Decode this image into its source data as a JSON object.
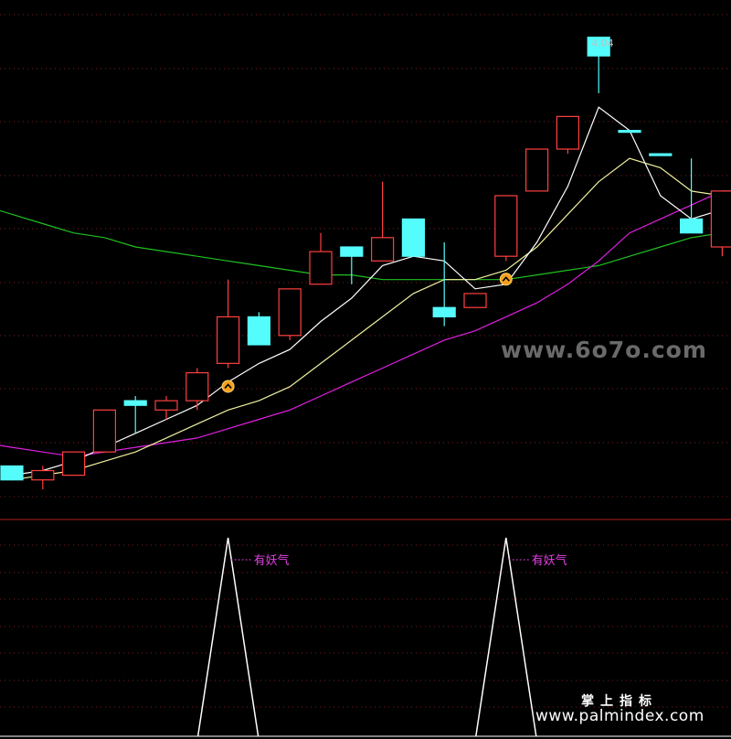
{
  "chart_data": [
    {
      "type": "candlestick",
      "max_price_label": "4.04",
      "colors": {
        "up": "#ff4040",
        "down": "#54fcfc",
        "ma_white": "#ffffff",
        "ma_yellow": "#f0f0a0",
        "ma_magenta": "#e020e0",
        "ma_green": "#20c020",
        "grid": "#7a1f1f",
        "signal_icon": "#f4a21c"
      },
      "candles": [
        {
          "i": 0,
          "o": 3.36,
          "c": 3.33,
          "h": 3.36,
          "l": 3.33,
          "up": false
        },
        {
          "i": 1,
          "o": 3.33,
          "c": 3.35,
          "h": 3.36,
          "l": 3.31,
          "up": true
        },
        {
          "i": 2,
          "o": 3.34,
          "c": 3.39,
          "h": 3.39,
          "l": 3.34,
          "up": true
        },
        {
          "i": 3,
          "o": 3.39,
          "c": 3.48,
          "h": 3.48,
          "l": 3.39,
          "up": true
        },
        {
          "i": 4,
          "o": 3.5,
          "c": 3.49,
          "h": 3.51,
          "l": 3.43,
          "up": false
        },
        {
          "i": 5,
          "o": 3.48,
          "c": 3.5,
          "h": 3.51,
          "l": 3.46,
          "up": true
        },
        {
          "i": 6,
          "o": 3.5,
          "c": 3.56,
          "h": 3.57,
          "l": 3.48,
          "up": true
        },
        {
          "i": 7,
          "o": 3.58,
          "c": 3.68,
          "h": 3.76,
          "l": 3.57,
          "up": true
        },
        {
          "i": 8,
          "o": 3.68,
          "c": 3.62,
          "h": 3.69,
          "l": 3.62,
          "up": false
        },
        {
          "i": 9,
          "o": 3.64,
          "c": 3.74,
          "h": 3.74,
          "l": 3.63,
          "up": true
        },
        {
          "i": 10,
          "o": 3.75,
          "c": 3.82,
          "h": 3.86,
          "l": 3.75,
          "up": true
        },
        {
          "i": 11,
          "o": 3.83,
          "c": 3.81,
          "h": 3.83,
          "l": 3.75,
          "up": false
        },
        {
          "i": 12,
          "o": 3.8,
          "c": 3.85,
          "h": 3.97,
          "l": 3.8,
          "up": true
        },
        {
          "i": 13,
          "o": 3.89,
          "c": 3.81,
          "h": 3.89,
          "l": 3.81,
          "up": false
        },
        {
          "i": 14,
          "o": 3.7,
          "c": 3.68,
          "h": 3.84,
          "l": 3.66,
          "up": false
        },
        {
          "i": 15,
          "o": 3.7,
          "c": 3.73,
          "h": 3.73,
          "l": 3.7,
          "up": true
        },
        {
          "i": 16,
          "o": 3.81,
          "c": 3.94,
          "h": 3.94,
          "l": 3.8,
          "up": true
        },
        {
          "i": 17,
          "o": 3.95,
          "c": 4.04,
          "h": 4.04,
          "l": 3.95,
          "up": true
        },
        {
          "i": 18,
          "o": 4.04,
          "c": 4.11,
          "h": 4.11,
          "l": 4.03,
          "up": true
        },
        {
          "i": 19,
          "o": 4.28,
          "c": 4.24,
          "h": 4.28,
          "l": 4.16,
          "up": false
        },
        {
          "i": 20,
          "o": 4.08,
          "c": 4.08,
          "h": 4.08,
          "l": 4.08,
          "up": false
        },
        {
          "i": 21,
          "o": 4.03,
          "c": 4.03,
          "h": 4.03,
          "l": 4.03,
          "up": false
        },
        {
          "i": 22,
          "o": 3.89,
          "c": 3.86,
          "h": 4.02,
          "l": 3.86,
          "up": false
        },
        {
          "i": 23,
          "o": 3.83,
          "c": 3.95,
          "h": 3.95,
          "l": 3.81,
          "up": true
        }
      ],
      "ma_white": [
        3.34,
        3.35,
        3.37,
        3.4,
        3.43,
        3.46,
        3.49,
        3.54,
        3.58,
        3.61,
        3.67,
        3.72,
        3.79,
        3.81,
        3.8,
        3.74,
        3.75,
        3.84,
        3.96,
        4.13,
        4.08,
        3.94,
        3.89,
        3.91
      ],
      "ma_yellow": [
        3.33,
        3.34,
        3.35,
        3.37,
        3.39,
        3.42,
        3.45,
        3.48,
        3.5,
        3.53,
        3.58,
        3.63,
        3.68,
        3.73,
        3.76,
        3.76,
        3.78,
        3.83,
        3.9,
        3.97,
        4.02,
        4.0,
        3.95,
        3.94
      ],
      "ma_magenta": [
        3.4,
        3.39,
        3.38,
        3.39,
        3.4,
        3.41,
        3.42,
        3.44,
        3.46,
        3.48,
        3.51,
        3.54,
        3.57,
        3.6,
        3.63,
        3.65,
        3.68,
        3.71,
        3.75,
        3.8,
        3.86,
        3.89,
        3.92,
        3.95
      ],
      "ma_green": [
        3.9,
        3.88,
        3.86,
        3.85,
        3.83,
        3.82,
        3.81,
        3.8,
        3.79,
        3.78,
        3.77,
        3.77,
        3.76,
        3.76,
        3.76,
        3.76,
        3.76,
        3.77,
        3.78,
        3.79,
        3.81,
        3.83,
        3.85,
        3.86
      ],
      "signal_markers": [
        7,
        16
      ]
    },
    {
      "type": "line",
      "values": [
        0,
        0,
        0,
        0,
        0,
        0,
        0,
        1,
        0,
        0,
        0,
        0,
        0,
        0,
        0,
        0,
        1,
        0,
        0,
        0,
        0,
        0,
        0,
        0
      ],
      "ylim": [
        0,
        1
      ],
      "annotations": [
        {
          "x": 7,
          "text": "有妖气"
        },
        {
          "x": 16,
          "text": "有妖气"
        }
      ]
    }
  ],
  "watermarks": {
    "top": "www.6o7o.com",
    "cn": "掌上指标",
    "url": "www.palmindex.com"
  }
}
